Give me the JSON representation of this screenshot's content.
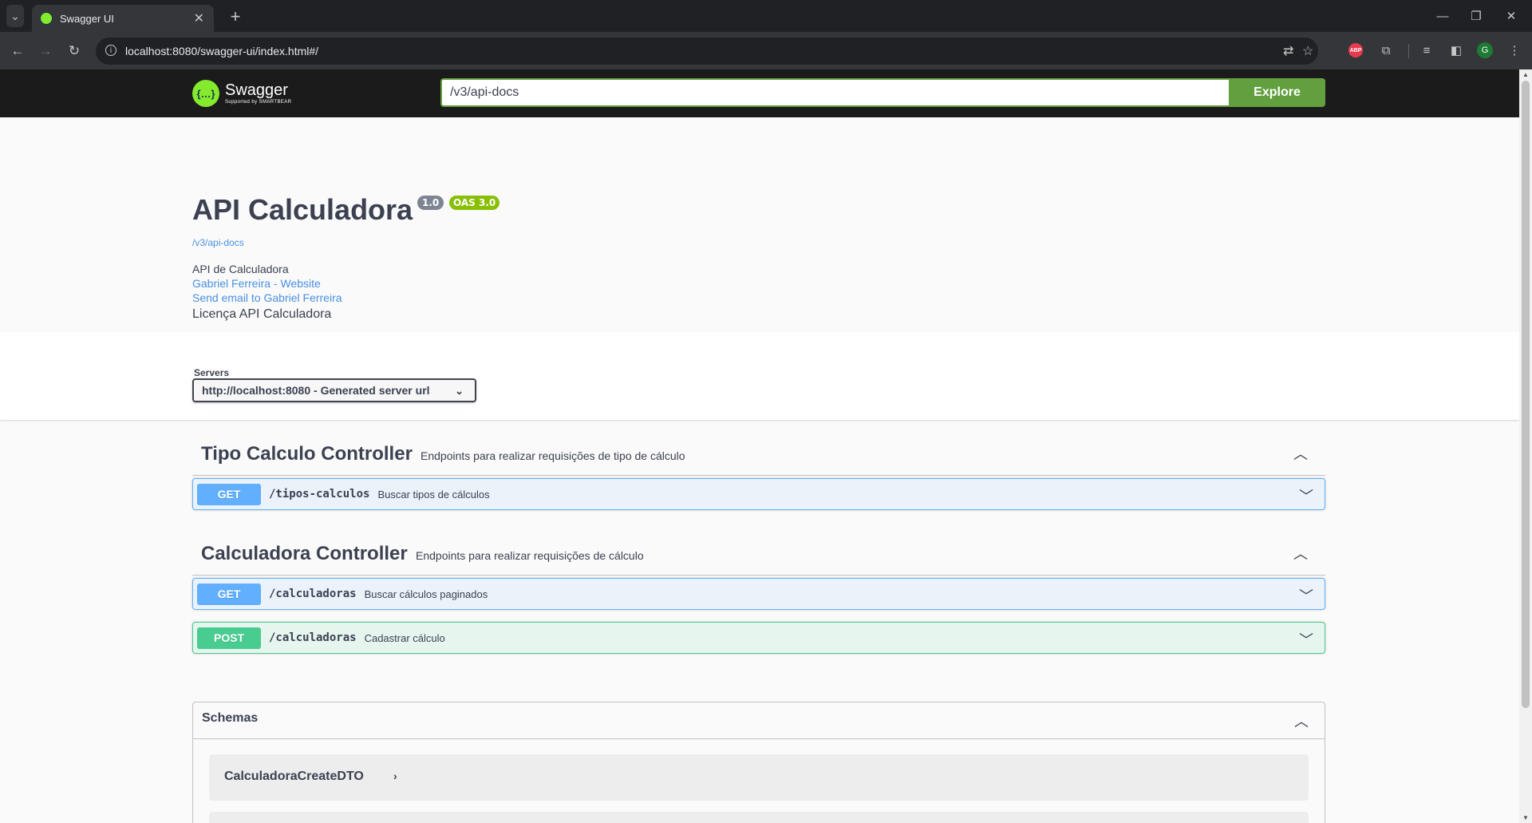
{
  "browser": {
    "tab_title": "Swagger UI",
    "tab_close": "✕",
    "new_tab": "+",
    "url": "localhost:8080/swagger-ui/index.html#/",
    "window_controls": {
      "minimize": "—",
      "restore": "❐",
      "close": "✕"
    },
    "extensions": {
      "abp": "ABP",
      "profile_initial": "G"
    }
  },
  "swagger": {
    "logo_name": "Swagger",
    "logo_sub": "Supported by SMARTBEAR",
    "search_value": "/v3/api-docs",
    "explore_label": "Explore"
  },
  "info": {
    "title": "API Calculadora",
    "version": "1.0",
    "oas": "OAS 3.0",
    "spec_url": "/v3/api-docs",
    "description": "API de Calculadora",
    "contact_website": "Gabriel Ferreira - Website",
    "contact_email": "Send email to Gabriel Ferreira",
    "license": "Licença API Calculadora"
  },
  "servers": {
    "label": "Servers",
    "selected": "http://localhost:8080 - Generated server url"
  },
  "tags": [
    {
      "name": "Tipo Calculo Controller",
      "description": "Endpoints para realizar requisições de tipo de cálculo",
      "operations": [
        {
          "method": "GET",
          "path": "/tipos-calculos",
          "summary": "Buscar tipos de cálculos"
        }
      ]
    },
    {
      "name": "Calculadora Controller",
      "description": "Endpoints para realizar requisições de cálculo",
      "operations": [
        {
          "method": "GET",
          "path": "/calculadoras",
          "summary": "Buscar cálculos paginados"
        },
        {
          "method": "POST",
          "path": "/calculadoras",
          "summary": "Cadastrar cálculo"
        }
      ]
    }
  ],
  "schemas": {
    "title": "Schemas",
    "models": [
      "CalculadoraCreateDTO"
    ]
  },
  "colors": {
    "get": "#61affe",
    "post": "#49cc90",
    "explore": "#62a03f",
    "topbar": "#1b1b1b",
    "oas_badge": "#89bf04",
    "version_badge": "#7d8492",
    "link": "#4990e2"
  }
}
